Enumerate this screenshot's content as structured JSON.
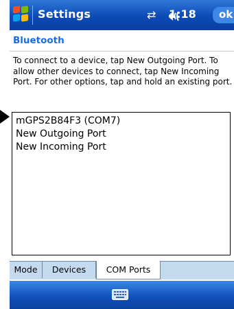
{
  "titlebar": {
    "title": "Settings",
    "clock": "1:18",
    "ok_label": "ok",
    "icons": [
      "windows-start-icon",
      "connectivity-icon",
      "volume-icon"
    ]
  },
  "page": {
    "title": "Bluetooth",
    "instructions": "To connect to a device, tap New Outgoing Port. To allow other devices to connect, tap New Incoming Port. For other options, tap and hold an existing port."
  },
  "ports": {
    "items": [
      {
        "label": "mGPS2B84F3 (COM7)"
      },
      {
        "label": "New Outgoing Port"
      },
      {
        "label": "New Incoming Port"
      }
    ]
  },
  "tabs": [
    {
      "label": "Mode"
    },
    {
      "label": "Devices"
    },
    {
      "label": "COM Ports",
      "active": true
    }
  ],
  "menubar": {
    "icon": "keyboard-icon"
  },
  "colors": {
    "titlebar": "#0c4ab5",
    "header_text": "#1b6ce0",
    "tabbar": "#c4dbef"
  }
}
